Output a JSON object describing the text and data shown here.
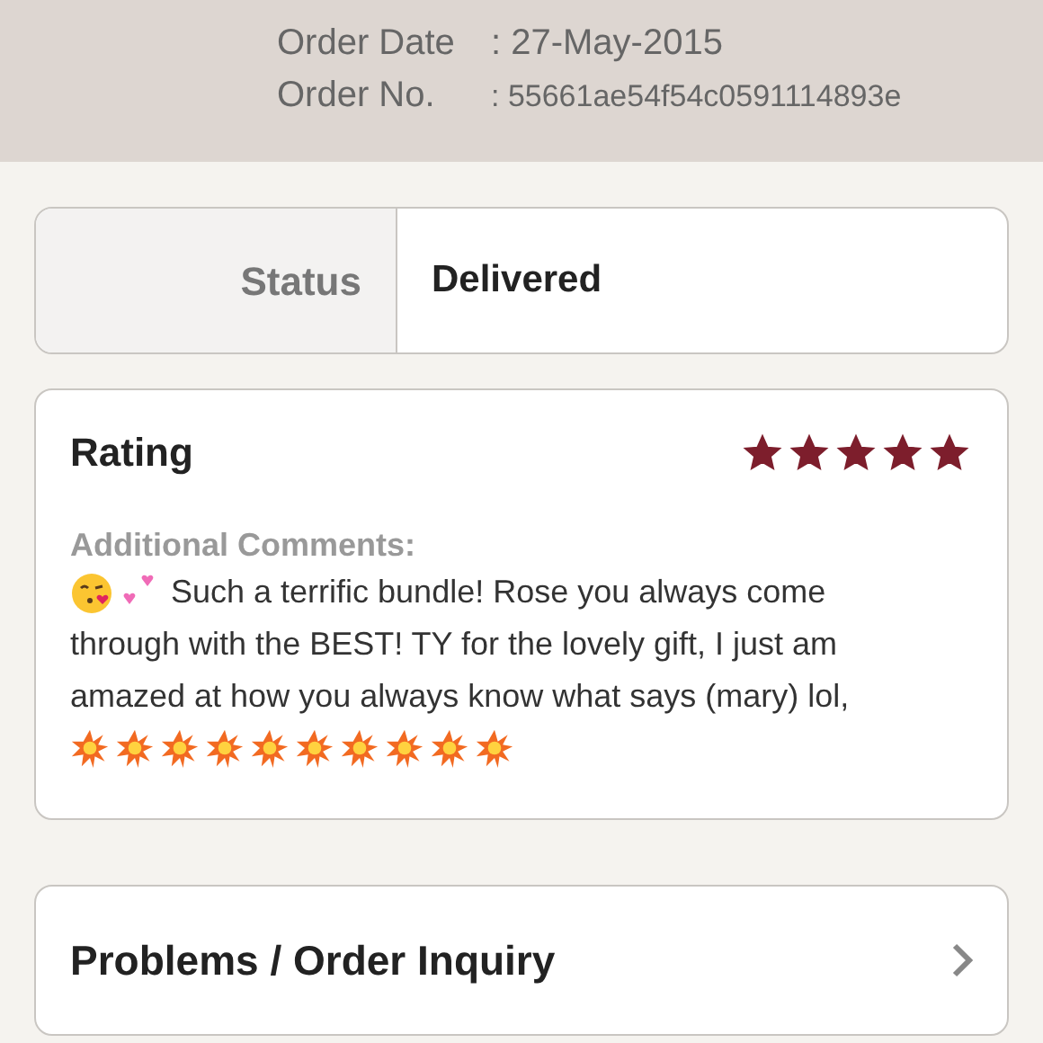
{
  "order": {
    "date_label": "Order Date",
    "date": ": 27-May-2015",
    "number_label": "Order No.",
    "number": ": 55661ae54f54c0591114893e"
  },
  "status": {
    "label": "Status",
    "value": "Delivered"
  },
  "rating": {
    "title": "Rating",
    "stars": 5,
    "comments_label": "Additional Comments:",
    "comment_lines": [
      "Such a terrific bundle! Rose you always come",
      "through with the BEST! TY for the lovely gift, I just am",
      "amazed at how you always know what says (mary) lol,"
    ]
  },
  "inquiry": {
    "label": "Problems / Order Inquiry"
  }
}
